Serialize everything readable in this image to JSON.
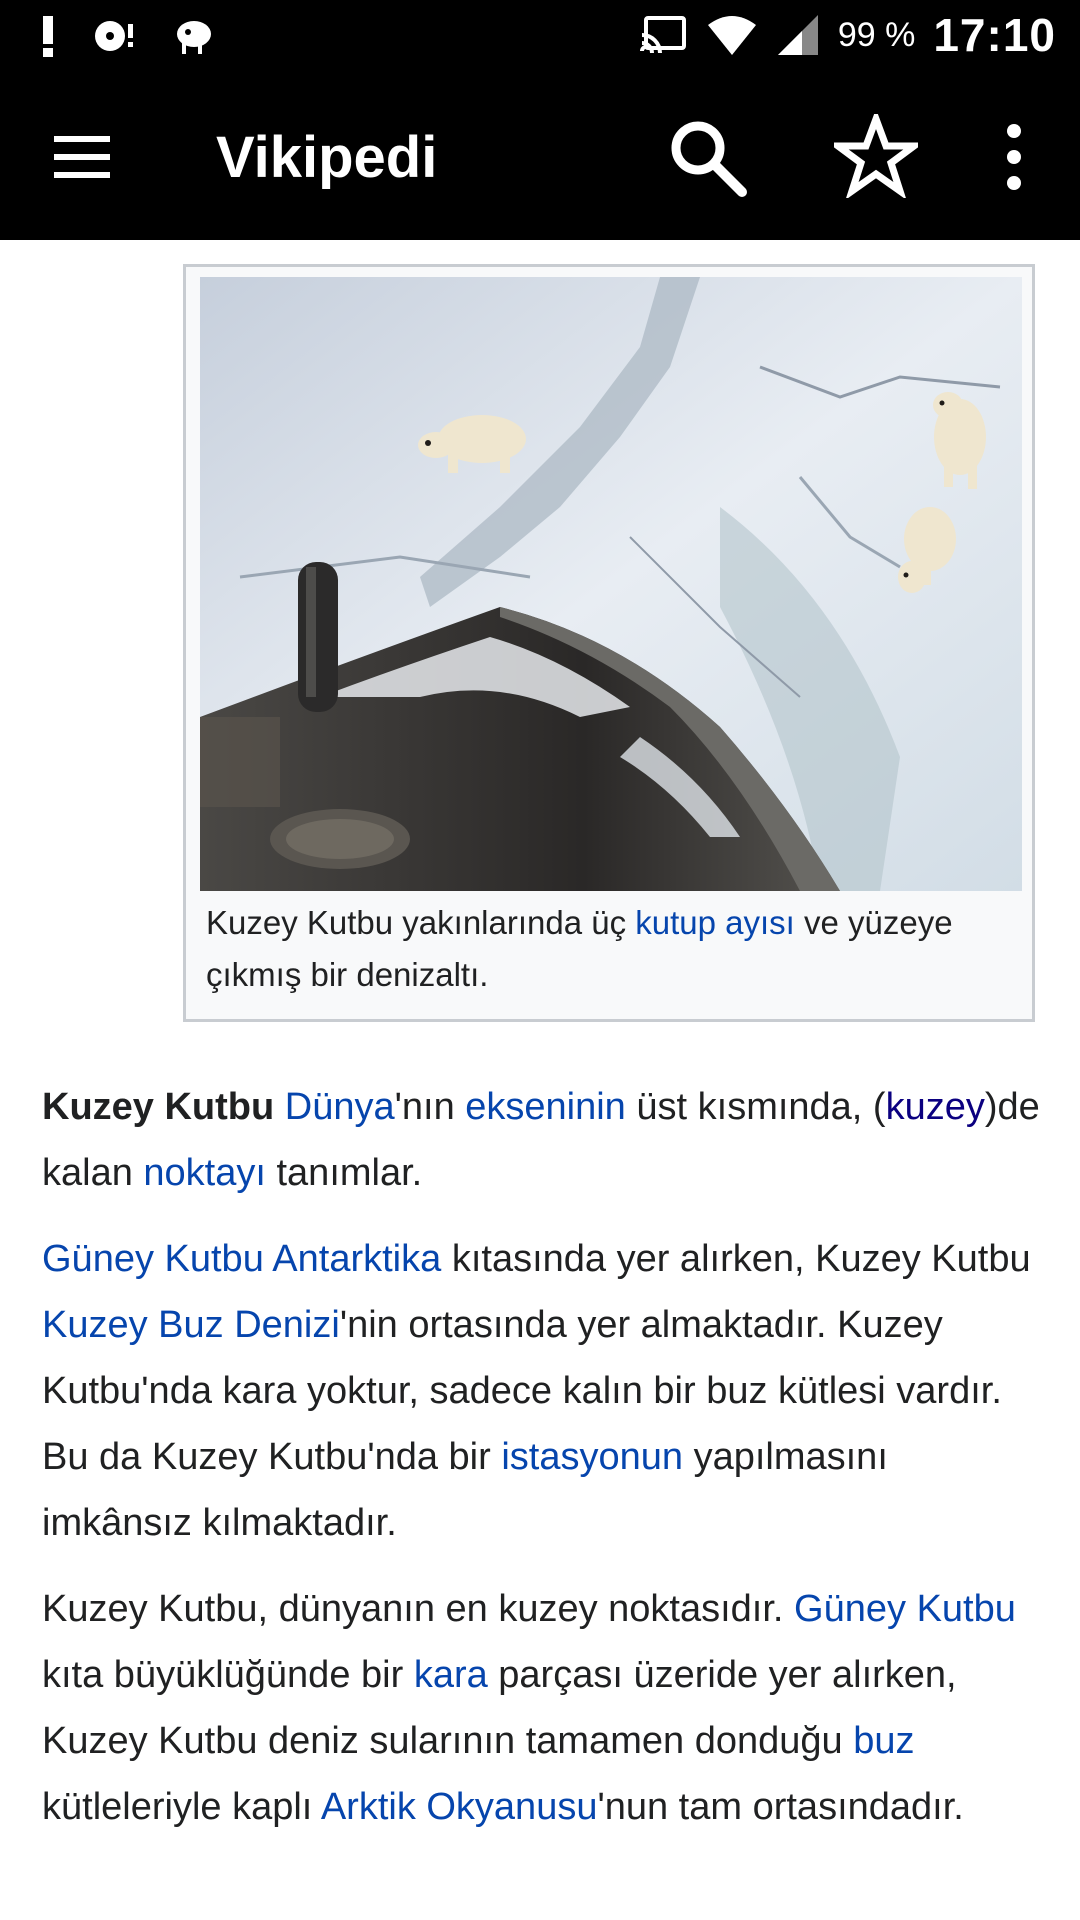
{
  "status_bar": {
    "battery": "99 %",
    "time": "17:10",
    "icons": [
      "alert-icon",
      "media-icon",
      "kiwi-icon",
      "cast-icon",
      "wifi-icon",
      "signal-icon"
    ]
  },
  "toolbar": {
    "title": "Vikipedi",
    "icons": [
      "menu-icon",
      "search-icon",
      "star-icon",
      "more-icon"
    ]
  },
  "figure": {
    "image_subject": "polar bears near surfaced submarine on ice",
    "caption": {
      "t1": "Kuzey Kutbu yakınlarında üç ",
      "link1": "kutup ayısı",
      "t2": " ve yüzeye çıkmış bir denizaltı."
    }
  },
  "article": {
    "p1": {
      "bold": "Kuzey Kutbu",
      "t0": " ",
      "link1": "Dünya",
      "t1": "'nın ",
      "link2": "ekseninin",
      "t2": " üst kısmında, (",
      "link3": "kuzey",
      "t3": ")de kalan ",
      "link4": "noktayı",
      "t4": " tanımlar."
    },
    "p2": {
      "link1": "Güney Kutbu",
      "t0": " ",
      "link2": "Antarktika",
      "t1": " kıtasında yer alırken, Kuzey Kutbu ",
      "link3": "Kuzey Buz Denizi",
      "t2": "'nin ortasında yer almaktadır. Kuzey Kutbu'nda kara yoktur, sadece kalın bir buz kütlesi vardır. Bu da Kuzey Kutbu'nda bir ",
      "link4": "istasyonun",
      "t3": " yapılmasını imkânsız kılmaktadır."
    },
    "p3": {
      "t1": "Kuzey Kutbu, dünyanın en kuzey noktasıdır. ",
      "link1": "Güney Kutbu",
      "t2": " kıta büyüklüğünde bir ",
      "link2": "kara",
      "t3": " parçası üzeride yer alırken, Kuzey Kutbu deniz sularının tamamen donduğu ",
      "link3": "buz",
      "t4": " kütleleriyle kaplı ",
      "link4": "Arktik Okyanusu",
      "t5": "'nun tam ortasındadır."
    }
  },
  "colors": {
    "link": "#0645ad",
    "visited_link": "#0b0080",
    "bar": "#000000"
  }
}
